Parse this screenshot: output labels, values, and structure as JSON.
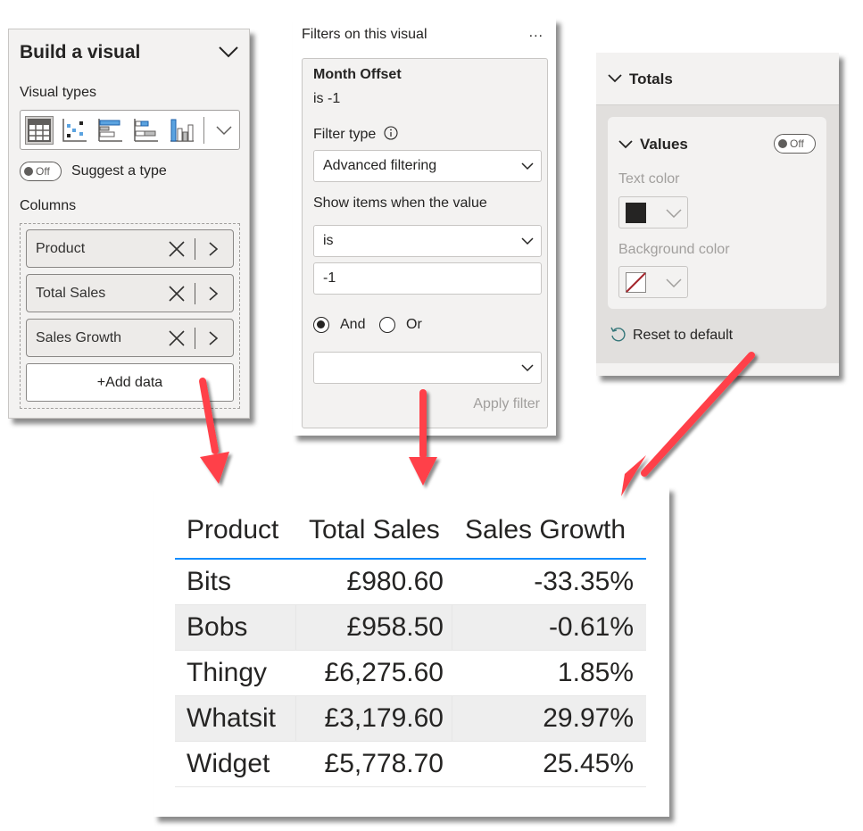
{
  "build_visual": {
    "title": "Build a visual",
    "visual_types_label": "Visual types",
    "visual_types": [
      {
        "icon": "table-icon",
        "selected": true
      },
      {
        "icon": "scatter-chart-icon",
        "selected": false
      },
      {
        "icon": "clustered-bar-chart-icon",
        "selected": false
      },
      {
        "icon": "stacked-bar-chart-icon",
        "selected": false
      },
      {
        "icon": "column-chart-icon",
        "selected": false
      }
    ],
    "suggest_toggle": {
      "state": "Off",
      "label": "Suggest a type"
    },
    "columns_label": "Columns",
    "columns": [
      {
        "name": "Product"
      },
      {
        "name": "Total Sales"
      },
      {
        "name": "Sales Growth"
      }
    ],
    "add_data_label": "+Add data"
  },
  "filters": {
    "header": "Filters on this visual",
    "more_label": "...",
    "field_name": "Month Offset",
    "summary": "is -1",
    "filter_type_label": "Filter type",
    "filter_type_value": "Advanced filtering",
    "show_items_label": "Show items when the value",
    "condition1_operator": "is",
    "condition1_value": "-1",
    "logic_options": [
      {
        "label": "And",
        "selected": true
      },
      {
        "label": "Or",
        "selected": false
      }
    ],
    "condition2_operator": "",
    "apply_label": "Apply filter"
  },
  "totals": {
    "section_label": "Totals",
    "values_label": "Values",
    "values_toggle": "Off",
    "text_color_label": "Text color",
    "text_color": "#252423",
    "background_color_label": "Background color",
    "background_color": "none",
    "reset_label": "Reset to default"
  },
  "table": {
    "headers": [
      "Product",
      "Total Sales",
      "Sales Growth"
    ],
    "rows": [
      [
        "Bits",
        "£980.60",
        "-33.35%"
      ],
      [
        "Bobs",
        "£958.50",
        "-0.61%"
      ],
      [
        "Thingy",
        "£6,275.60",
        "1.85%"
      ],
      [
        "Whatsit",
        "£3,179.60",
        "29.97%"
      ],
      [
        "Widget",
        "£5,778.70",
        "25.45%"
      ]
    ]
  },
  "colors": {
    "accent": "#118dff",
    "arrow": "#ff4148",
    "panel_bg": "#f3f2f1"
  }
}
